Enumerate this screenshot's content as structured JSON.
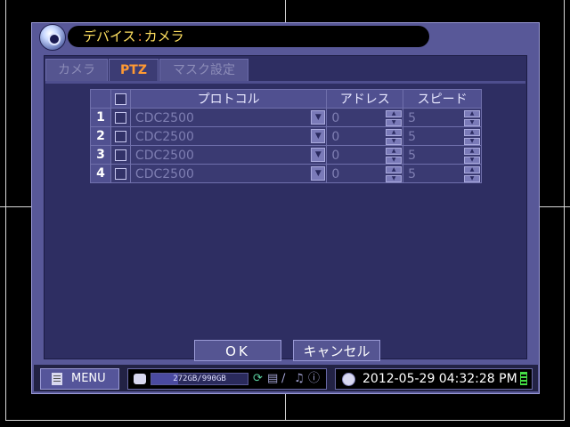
{
  "window": {
    "title_part1": "デバイス",
    "title_sep": ":",
    "title_part2": "カメラ"
  },
  "tabs": [
    {
      "label": "カメラ",
      "active": false
    },
    {
      "label": "PTZ",
      "active": true
    },
    {
      "label": "マスク設定",
      "active": false
    }
  ],
  "table": {
    "headers": {
      "protocol": "プロトコル",
      "address": "アドレス",
      "speed": "スピード"
    },
    "rows": [
      {
        "index": "1",
        "protocol": "CDC2500",
        "address": "0",
        "speed": "5"
      },
      {
        "index": "2",
        "protocol": "CDC2500",
        "address": "0",
        "speed": "5"
      },
      {
        "index": "3",
        "protocol": "CDC2500",
        "address": "0",
        "speed": "5"
      },
      {
        "index": "4",
        "protocol": "CDC2500",
        "address": "0",
        "speed": "5"
      }
    ]
  },
  "buttons": {
    "ok": "OK",
    "cancel": "キャンセル"
  },
  "status": {
    "menu_label": "MENU",
    "storage_text": "272GB/990GB",
    "storage_used_fraction": 0.275,
    "datetime": "2012-05-29 04:32:28 PM"
  },
  "colors": {
    "accent_title": "#ffe060",
    "accent_tab": "#ff9933",
    "dialog_bg": "#585898",
    "content_bg": "#2e2e62"
  }
}
